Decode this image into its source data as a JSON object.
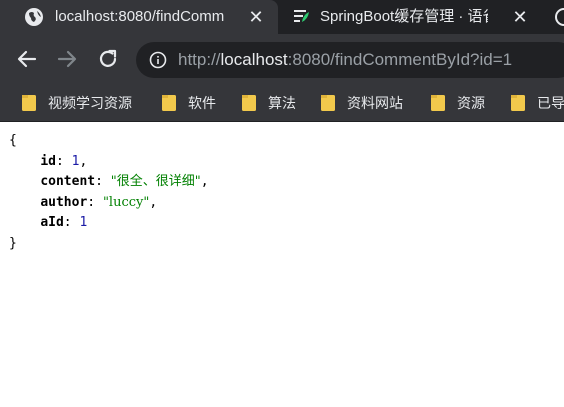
{
  "browser": {
    "tabs": [
      {
        "title": "localhost:8080/findComm",
        "active": true,
        "favicon": "globe-icon"
      },
      {
        "title": "SpringBoot缓存管理 · 语雀",
        "active": false,
        "favicon": "yuque-icon"
      }
    ],
    "url": {
      "scheme": "http://",
      "host": "localhost",
      "rest": ":8080/findCommentById?id=1"
    },
    "bookmarks": [
      {
        "label": "视频学习资源"
      },
      {
        "label": "软件"
      },
      {
        "label": "算法"
      },
      {
        "label": "资料网站"
      },
      {
        "label": "资源"
      },
      {
        "label": "已导"
      }
    ]
  },
  "json_view": {
    "open_brace": "{",
    "close_brace": "}",
    "fields": [
      {
        "key": "id",
        "value": "1",
        "type": "number",
        "trailing": ","
      },
      {
        "key": "content",
        "value": "\"很全、很详细\"",
        "type": "string",
        "trailing": ","
      },
      {
        "key": "author",
        "value": "\"luccy\"",
        "type": "string",
        "trailing": ","
      },
      {
        "key": "aId",
        "value": "1",
        "type": "number",
        "trailing": ""
      }
    ]
  },
  "colors": {
    "tab_strip": "#202124",
    "toolbar": "#35363a",
    "text_light": "#e8eaed",
    "text_dim": "#9aa0a6",
    "folder": "#f2c94c",
    "json_string": "#008000",
    "json_number": "#1a1aa6"
  }
}
